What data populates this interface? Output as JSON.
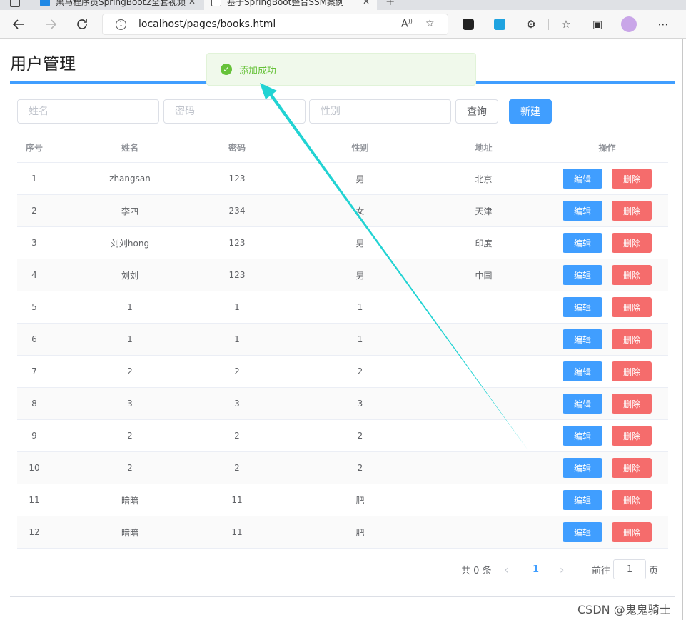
{
  "browser": {
    "tabs": [
      {
        "title": "黑马程序员SpringBoot2全套视频"
      },
      {
        "title": "基于SpringBoot整合SSM案例"
      }
    ],
    "address": "localhost/pages/books.html"
  },
  "page": {
    "title": "用户管理"
  },
  "toast": {
    "message": "添加成功",
    "color": "#67c23a"
  },
  "search": {
    "name_placeholder": "姓名",
    "password_placeholder": "密码",
    "gender_placeholder": "性别",
    "query_label": "查询",
    "create_label": "新建"
  },
  "table": {
    "headers": {
      "index": "序号",
      "name": "姓名",
      "password": "密码",
      "gender": "性别",
      "address": "地址",
      "operations": "操作"
    },
    "edit_label": "编辑",
    "delete_label": "删除",
    "rows": [
      {
        "index": "1",
        "name": "zhangsan",
        "password": "123",
        "gender": "男",
        "address": "北京"
      },
      {
        "index": "2",
        "name": "李四",
        "password": "234",
        "gender": "女",
        "address": "天津"
      },
      {
        "index": "3",
        "name": "刘刘hong",
        "password": "123",
        "gender": "男",
        "address": "印度"
      },
      {
        "index": "4",
        "name": "刘刘",
        "password": "123",
        "gender": "男",
        "address": "中国"
      },
      {
        "index": "5",
        "name": "1",
        "password": "1",
        "gender": "1",
        "address": ""
      },
      {
        "index": "6",
        "name": "1",
        "password": "1",
        "gender": "1",
        "address": ""
      },
      {
        "index": "7",
        "name": "2",
        "password": "2",
        "gender": "2",
        "address": ""
      },
      {
        "index": "8",
        "name": "3",
        "password": "3",
        "gender": "3",
        "address": ""
      },
      {
        "index": "9",
        "name": "2",
        "password": "2",
        "gender": "2",
        "address": ""
      },
      {
        "index": "10",
        "name": "2",
        "password": "2",
        "gender": "2",
        "address": ""
      },
      {
        "index": "11",
        "name": "暗暗",
        "password": "11",
        "gender": "肥",
        "address": ""
      },
      {
        "index": "12",
        "name": "暗暗",
        "password": "11",
        "gender": "肥",
        "address": ""
      }
    ]
  },
  "pagination": {
    "total": "共 0 条",
    "current_page": "1",
    "goto_label": "前往",
    "goto_value": "1",
    "page_suffix": "页"
  },
  "watermark": "CSDN @鬼鬼骑士",
  "colors": {
    "primary": "#409eff",
    "danger": "#f56c6c",
    "success": "#67c23a",
    "annotation_arrow": "#22d3d3"
  }
}
